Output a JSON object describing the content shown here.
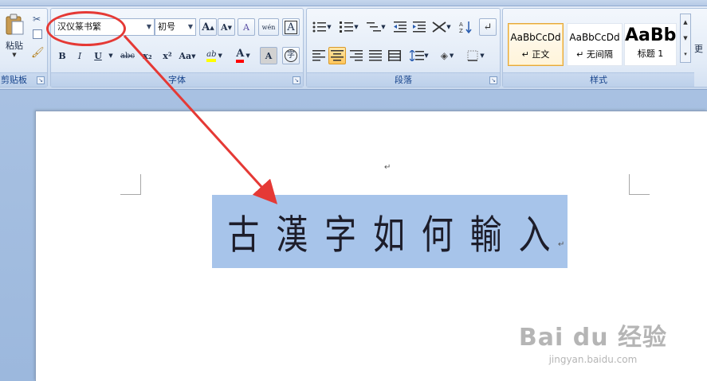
{
  "clipboard": {
    "paste_label": "粘贴",
    "group_label": "剪贴板"
  },
  "font": {
    "name_value": "汉仪篆书繁",
    "size_value": "初号",
    "group_label": "字体",
    "buttons": {
      "grow": "A",
      "shrink": "A",
      "clear": "A",
      "phonetic": "wén",
      "border": "A",
      "bold": "B",
      "italic": "I",
      "underline": "U",
      "strike": "abc",
      "subscript": "x₂",
      "superscript": "x²",
      "case": "Aa",
      "highlight": "ab",
      "color": "A",
      "shading": "A",
      "enclose": "字"
    }
  },
  "paragraph": {
    "group_label": "段落"
  },
  "styles": {
    "group_label": "样式",
    "items": [
      {
        "sample": "AaBbCcDd",
        "name": "↵ 正文"
      },
      {
        "sample": "AaBbCcDd",
        "name": "↵ 无间隔"
      },
      {
        "sample": "AaBb",
        "name": "标题 1"
      }
    ],
    "change_label": "更"
  },
  "document": {
    "text_glyphs": [
      "古",
      "漢",
      "字",
      "如",
      "何",
      "輸",
      "入"
    ],
    "para_mark": "↵"
  },
  "watermark": {
    "main": "Bai du 经验",
    "sub": "jingyan.baidu.com"
  },
  "colors": {
    "annotation": "#e53935",
    "selection": "#a7c4ea",
    "highlight": "#ffff00",
    "font_color": "#ff0000"
  }
}
